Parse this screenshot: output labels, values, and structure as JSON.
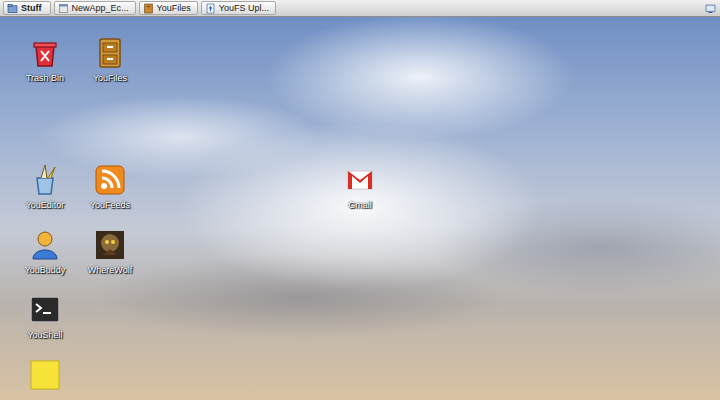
{
  "taskbar": {
    "start_menu": {
      "label": "Stuff"
    },
    "tabs": [
      {
        "label": "NewApp_Ec...",
        "selected": false
      },
      {
        "label": "YouFiles",
        "selected": false
      },
      {
        "label": "YouFS Upl...",
        "selected": false
      }
    ]
  },
  "desktop": {
    "icons": [
      {
        "label": "Trash Bin"
      },
      {
        "label": "YouFiles"
      },
      {
        "label": "YouEditor"
      },
      {
        "label": "YouFeeds"
      },
      {
        "label": "YouBuddy"
      },
      {
        "label": "WhereWolf"
      },
      {
        "label": "YouShell"
      },
      {
        "label": "Gmail"
      }
    ]
  }
}
